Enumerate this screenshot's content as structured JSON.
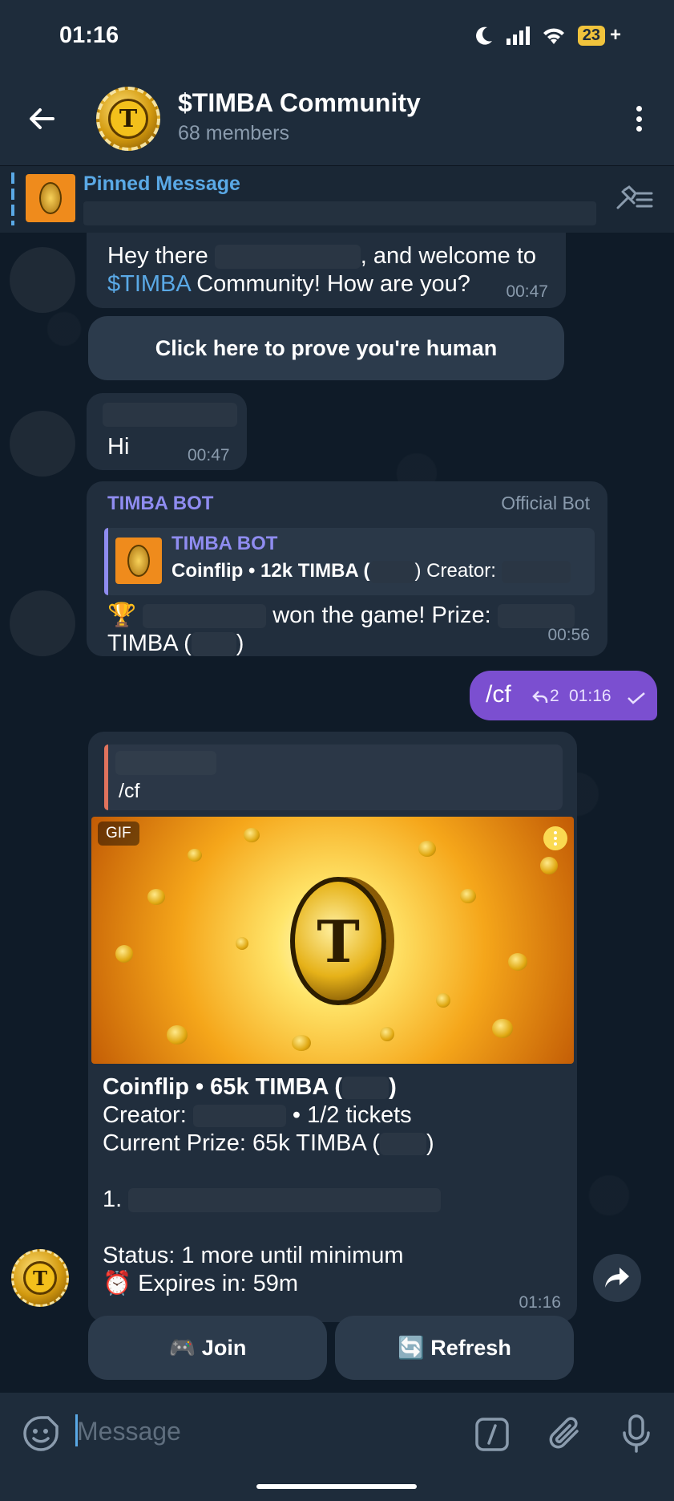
{
  "status_bar": {
    "time": "01:16",
    "battery": "23",
    "battery_suffix": "+"
  },
  "header": {
    "title": "$TIMBA Community",
    "subtitle": "68 members",
    "avatar_letter": "T"
  },
  "pinned": {
    "title": "Pinned Message"
  },
  "messages": {
    "welcome": {
      "text_1": "Hey there",
      "text_2": ", and welcome to",
      "link": "$TIMBA",
      "text_3": " Community! How are you?",
      "time": "00:47"
    },
    "verify_button": "Click here to prove you're human",
    "hi": {
      "text": "Hi",
      "time": "00:47"
    },
    "bot_result": {
      "sender": "TIMBA BOT",
      "badge": "Official Bot",
      "reply_sender": "TIMBA BOT",
      "reply_text_1": "Coinflip • 12k TIMBA (",
      "reply_text_2": ") Creator:",
      "trophy": "🏆",
      "line_1_suffix": "won the game! Prize:",
      "line_2_prefix": "TIMBA (",
      "line_2_suffix": ")",
      "time": "00:56"
    },
    "outgoing": {
      "text": "/cf",
      "replies": "2",
      "time": "01:16"
    },
    "coinflip": {
      "reply_text": "/cf",
      "gif_badge": "GIF",
      "coin_letter": "T",
      "line_1a": "Coinflip • 65k TIMBA (",
      "line_1b": ")",
      "line_2a": "Creator:",
      "line_2b": "• 1/2 tickets",
      "line_3a": "Current Prize: 65k TIMBA (",
      "line_3b": ")",
      "list_item": "1.",
      "status": "Status: 1 more until minimum",
      "expires": "⏰ Expires in: 59m",
      "time": "01:16"
    }
  },
  "keyboard": {
    "join": "🎮 Join",
    "refresh": "🔄 Refresh"
  },
  "input": {
    "placeholder": "Message"
  },
  "colors": {
    "accent": "#5aa9e6",
    "outgoing": "#7b4fd0",
    "bot_name": "#8f8cf0",
    "bubble": "#212e3d"
  }
}
